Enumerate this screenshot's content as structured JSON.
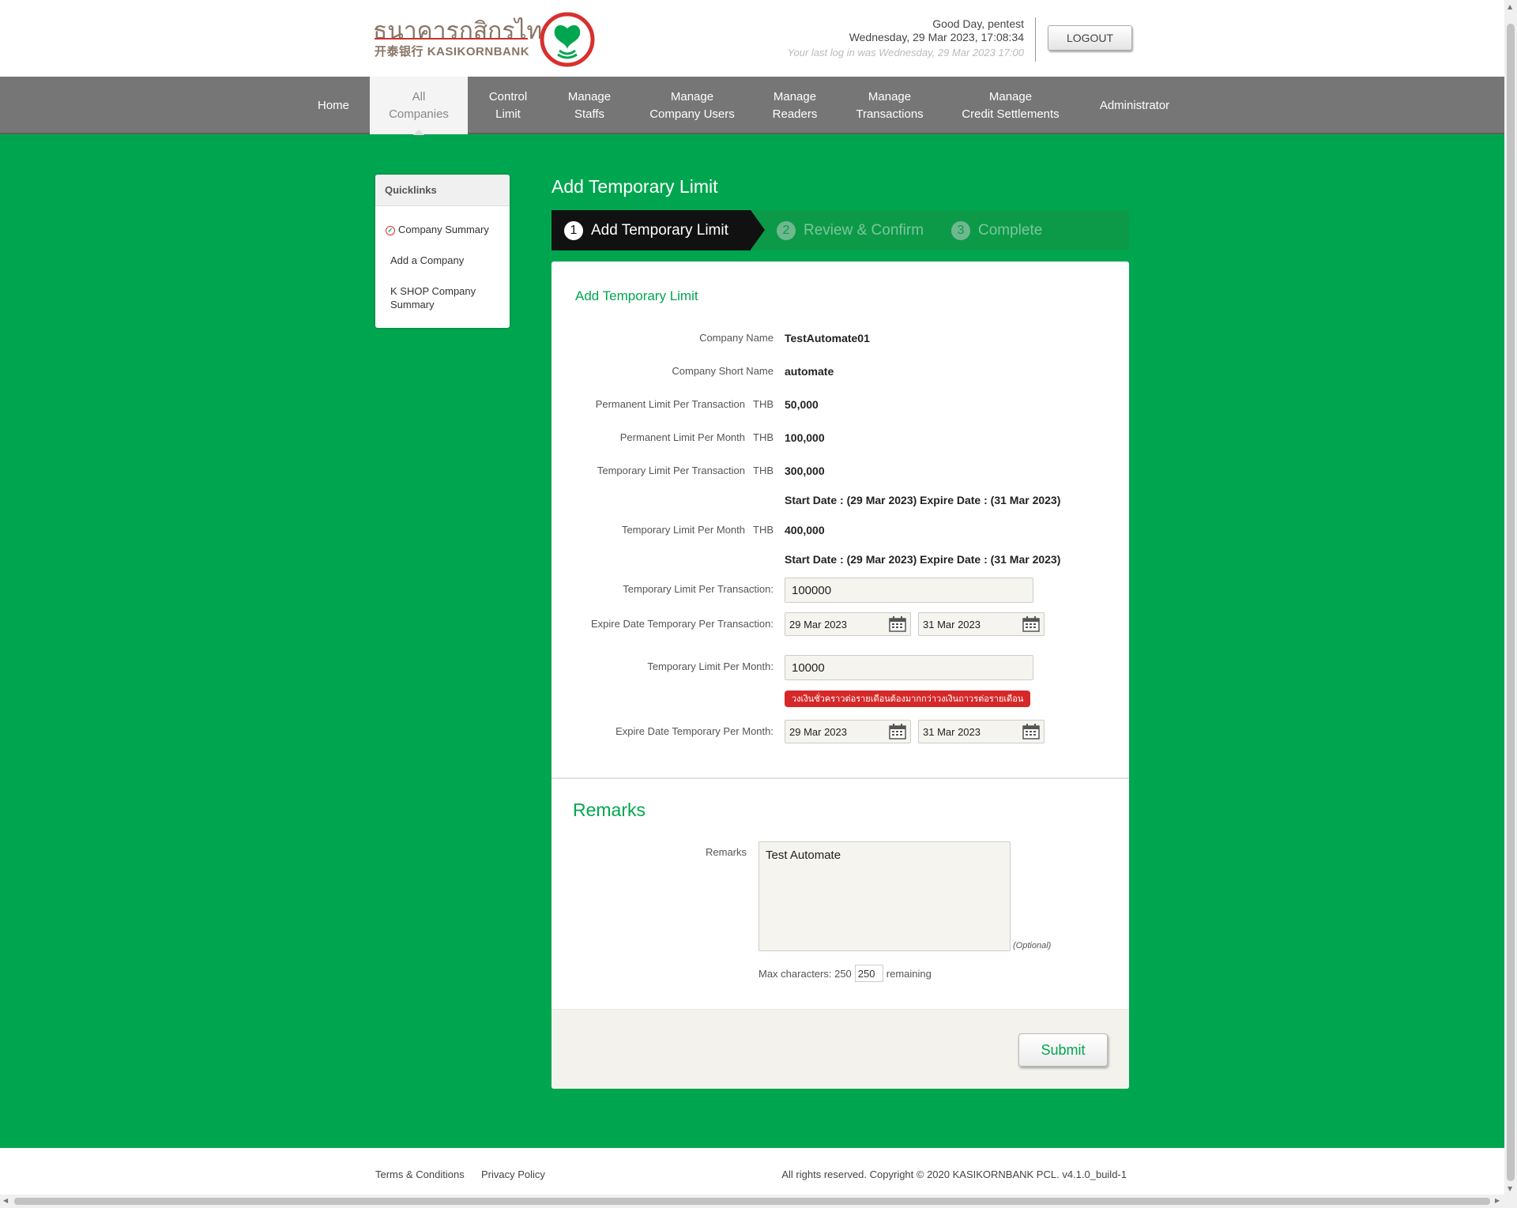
{
  "header": {
    "bank_name_thai": "ธนาคารกสิกรไทย",
    "bank_name_chinese": "开泰银行",
    "bank_name_english": "KASIKORNBANK",
    "greeting": "Good Day, pentest",
    "datetime": "Wednesday, 29 Mar 2023, 17:08:34",
    "last_login": "Your last log in was Wednesday, 29 Mar 2023 17:00",
    "logout_label": "LOGOUT"
  },
  "nav": {
    "items": [
      {
        "line1": "Home",
        "line2": ""
      },
      {
        "line1": "All",
        "line2": "Companies"
      },
      {
        "line1": "Control",
        "line2": "Limit"
      },
      {
        "line1": "Manage",
        "line2": "Staffs"
      },
      {
        "line1": "Manage",
        "line2": "Company Users"
      },
      {
        "line1": "Manage",
        "line2": "Readers"
      },
      {
        "line1": "Manage",
        "line2": "Transactions"
      },
      {
        "line1": "Manage",
        "line2": "Credit Settlements"
      },
      {
        "line1": "Administrator",
        "line2": ""
      }
    ],
    "active": "All Companies"
  },
  "quicklinks": {
    "title": "Quicklinks",
    "items": [
      "Company Summary",
      "Add a Company",
      "K SHOP Company",
      "Summary"
    ]
  },
  "page": {
    "title": "Add Temporary Limit",
    "steps": [
      {
        "num": "1",
        "label": "Add Temporary Limit"
      },
      {
        "num": "2",
        "label": "Review & Confirm"
      },
      {
        "num": "3",
        "label": "Complete"
      }
    ]
  },
  "form": {
    "section_title": "Add Temporary Limit",
    "currency": "THB",
    "labels": {
      "company_name": "Company Name",
      "company_short_name": "Company Short Name",
      "perm_per_txn": "Permanent Limit Per Transaction",
      "perm_per_month": "Permanent Limit Per Month",
      "temp_per_txn": "Temporary Limit Per Transaction",
      "temp_per_month": "Temporary Limit Per Month",
      "temp_per_txn_input": "Temporary Limit Per Transaction:",
      "expire_per_txn": "Expire Date Temporary Per Transaction:",
      "temp_per_month_input": "Temporary Limit Per Month:",
      "expire_per_month": "Expire Date Temporary Per Month:"
    },
    "values": {
      "company_name": "TestAutomate01",
      "company_short_name": "automate",
      "perm_per_txn": "50,000",
      "perm_per_month": "100,000",
      "temp_per_txn": "300,000",
      "temp_per_txn_dates": "Start Date : (29 Mar 2023)  Expire Date : (31 Mar 2023)",
      "temp_per_month": "400,000",
      "temp_per_month_dates": "Start Date : (29 Mar 2023)  Expire Date : (31 Mar 2023)"
    },
    "inputs": {
      "temp_per_txn": "100000",
      "txn_start": "29 Mar 2023",
      "txn_end": "31 Mar 2023",
      "temp_per_month": "10000",
      "month_start": "29 Mar 2023",
      "month_end": "31 Mar 2023"
    },
    "error_message": "วงเงินชั่วคราวต่อรายเดือนต้องมากกว่าวงเงินถาวรต่อรายเดือน"
  },
  "remarks": {
    "section_title": "Remarks",
    "label": "Remarks",
    "value": "Test Automate",
    "optional": "(Optional)",
    "max_chars_label": "Max characters: 250",
    "remaining_value": "250",
    "remaining_label": "remaining"
  },
  "submit_label": "Submit",
  "footer": {
    "terms": "Terms & Conditions",
    "privacy": "Privacy Policy",
    "copyright": "All rights reserved. Copyright © 2020 KASIKORNBANK PCL.  v4.1.0_build-1"
  },
  "colors": {
    "brand_green": "#00a64f",
    "nav_gray": "#767676",
    "error_red": "#d62828"
  }
}
